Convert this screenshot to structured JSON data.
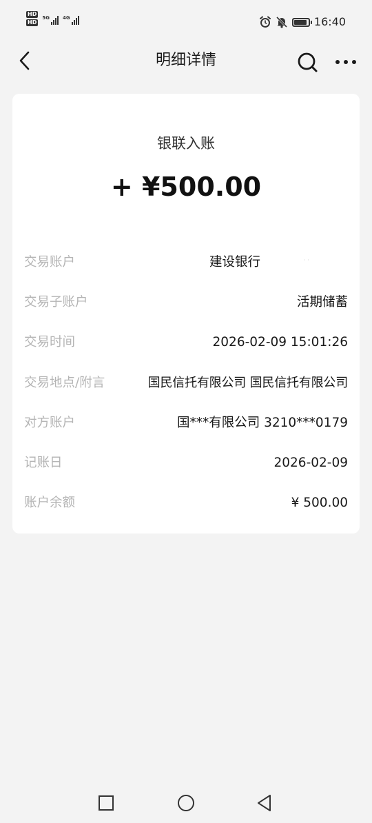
{
  "status_bar": {
    "hd1": "HD",
    "hd2": "HD",
    "net1": "5G",
    "net2": "4G",
    "time": "16:40",
    "battery_level": 0.9,
    "icons": [
      "alarm-icon",
      "mute-icon",
      "battery-icon"
    ]
  },
  "header": {
    "title": "明细详情",
    "back_icon": "chevron-left-icon",
    "search_icon": "search-icon",
    "more_icon": "more-horizontal-icon"
  },
  "transaction": {
    "type": "银联入账",
    "amount": "+ ¥500.00"
  },
  "details": [
    {
      "label": "交易账户",
      "value": "建设银行"
    },
    {
      "label": "交易子账户",
      "value": "活期储蓄"
    },
    {
      "label": "交易时间",
      "value": "2026-02-09 15:01:26"
    },
    {
      "label": "交易地点/附言",
      "value": "国民信托有限公司 国民信托有限公司"
    },
    {
      "label": "对方账户",
      "value": "国***有限公司 3210***0179"
    },
    {
      "label": "记账日",
      "value": "2026-02-09"
    },
    {
      "label": "账户余额",
      "value": "¥ 500.00"
    }
  ],
  "nav_bar": {
    "icons": [
      "square-recent-icon",
      "circle-home-icon",
      "triangle-back-icon"
    ]
  },
  "colors": {
    "background": "#f3f3f3",
    "card": "#ffffff",
    "label": "#b5b5b5",
    "text": "#1a1a1a"
  }
}
